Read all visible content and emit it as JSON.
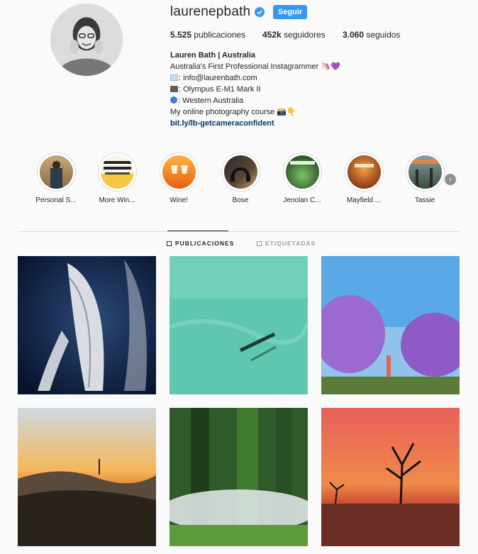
{
  "profile": {
    "username": "laurenepbath",
    "follow_label": "Seguir",
    "stats": {
      "posts_count": "5.525",
      "posts_label": "publicaciones",
      "followers_count": "452k",
      "followers_label": "seguidores",
      "following_count": "3.060",
      "following_label": "seguidos"
    },
    "bio": {
      "name": "Lauren Bath | Australia",
      "line1": "Australia's First Professional Instagrammer 🦄💜",
      "line2": ": info@laurenbath.com",
      "line3": ": Olympus E-M1 Mark II",
      "line4": ": Western Australia",
      "line5": "My online photography course 📸👇",
      "link": "bit.ly/lb-getcameraconfident"
    }
  },
  "highlights": [
    {
      "label": "Personal S...",
      "icon": "person-photo"
    },
    {
      "label": "More Win...",
      "icon": "winery-text"
    },
    {
      "label": "Wine!",
      "icon": "wine-glasses"
    },
    {
      "label": "Bose",
      "icon": "headphones"
    },
    {
      "label": "Jenolan C...",
      "icon": "caves"
    },
    {
      "label": "Mayfield ...",
      "icon": "garden"
    },
    {
      "label": "Tassie",
      "icon": "forest"
    }
  ],
  "tabs": {
    "posts": "PUBLICACIONES",
    "tagged": "ETIQUETADAS"
  },
  "colors": {
    "accent": "#3897f0",
    "link": "#003569",
    "text": "#262626",
    "muted": "#999999",
    "background": "#fafafa"
  }
}
